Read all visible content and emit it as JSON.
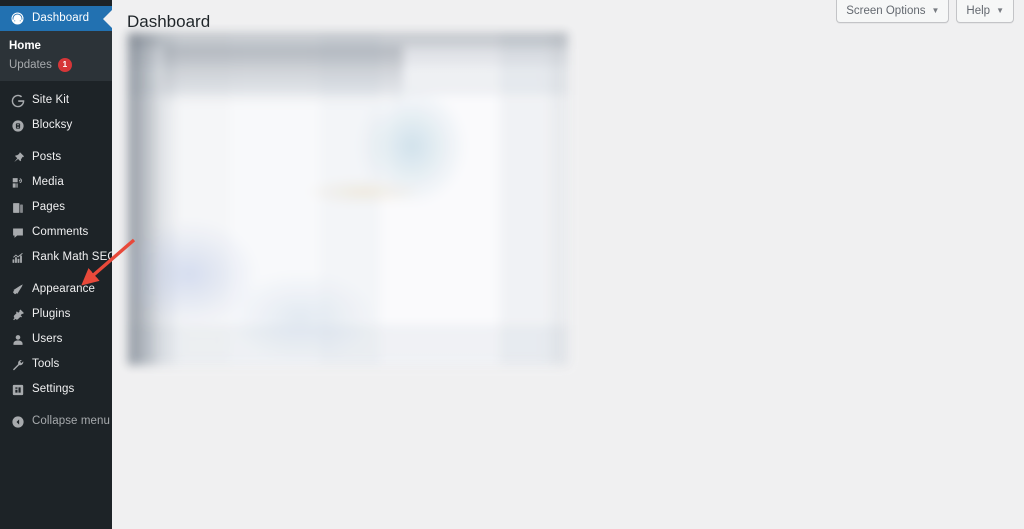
{
  "app": {
    "background_color": "#f0f0f1",
    "sidebar_color": "#1d2327",
    "accent_color": "#2271b1",
    "badge_color": "#d63638",
    "annotation_color": "#e8493a"
  },
  "sidebar": {
    "items": [
      {
        "label": "Dashboard",
        "icon": "dashboard-icon",
        "current": true,
        "dim": false
      },
      {
        "label": "Site Kit",
        "icon": "site-kit-icon",
        "current": false,
        "dim": false
      },
      {
        "label": "Blocksy",
        "icon": "blocksy-icon",
        "current": false,
        "dim": false
      },
      {
        "label": "Posts",
        "icon": "pin-icon",
        "current": false,
        "dim": false
      },
      {
        "label": "Media",
        "icon": "media-icon",
        "current": false,
        "dim": false
      },
      {
        "label": "Pages",
        "icon": "pages-icon",
        "current": false,
        "dim": false
      },
      {
        "label": "Comments",
        "icon": "comment-icon",
        "current": false,
        "dim": false
      },
      {
        "label": "Rank Math SEO",
        "icon": "rank-math-icon",
        "current": false,
        "dim": false
      },
      {
        "label": "Appearance",
        "icon": "appearance-icon",
        "current": false,
        "dim": false
      },
      {
        "label": "Plugins",
        "icon": "plugins-icon",
        "current": false,
        "dim": false
      },
      {
        "label": "Users",
        "icon": "users-icon",
        "current": false,
        "dim": false
      },
      {
        "label": "Tools",
        "icon": "tools-icon",
        "current": false,
        "dim": false
      },
      {
        "label": "Settings",
        "icon": "settings-icon",
        "current": false,
        "dim": false
      },
      {
        "label": "Collapse menu",
        "icon": "collapse-menu-icon",
        "current": false,
        "dim": true
      }
    ],
    "submenu": {
      "items": [
        {
          "label": "Home",
          "active": true,
          "badge": null
        },
        {
          "label": "Updates",
          "active": false,
          "badge": "1"
        }
      ]
    }
  },
  "screen_meta": {
    "screen_options_label": "Screen Options",
    "help_label": "Help",
    "caret": "▼"
  },
  "main": {
    "page_title": "Dashboard",
    "content_state": "blurred"
  }
}
